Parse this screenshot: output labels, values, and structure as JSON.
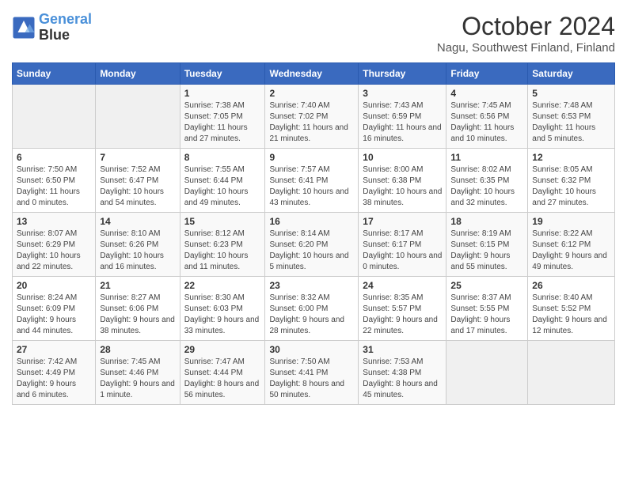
{
  "header": {
    "logo_line1": "General",
    "logo_line2": "Blue",
    "month_title": "October 2024",
    "location": "Nagu, Southwest Finland, Finland"
  },
  "days_of_week": [
    "Sunday",
    "Monday",
    "Tuesday",
    "Wednesday",
    "Thursday",
    "Friday",
    "Saturday"
  ],
  "weeks": [
    [
      {
        "day": "",
        "info": ""
      },
      {
        "day": "",
        "info": ""
      },
      {
        "day": "1",
        "info": "Sunrise: 7:38 AM\nSunset: 7:05 PM\nDaylight: 11 hours and 27 minutes."
      },
      {
        "day": "2",
        "info": "Sunrise: 7:40 AM\nSunset: 7:02 PM\nDaylight: 11 hours and 21 minutes."
      },
      {
        "day": "3",
        "info": "Sunrise: 7:43 AM\nSunset: 6:59 PM\nDaylight: 11 hours and 16 minutes."
      },
      {
        "day": "4",
        "info": "Sunrise: 7:45 AM\nSunset: 6:56 PM\nDaylight: 11 hours and 10 minutes."
      },
      {
        "day": "5",
        "info": "Sunrise: 7:48 AM\nSunset: 6:53 PM\nDaylight: 11 hours and 5 minutes."
      }
    ],
    [
      {
        "day": "6",
        "info": "Sunrise: 7:50 AM\nSunset: 6:50 PM\nDaylight: 11 hours and 0 minutes."
      },
      {
        "day": "7",
        "info": "Sunrise: 7:52 AM\nSunset: 6:47 PM\nDaylight: 10 hours and 54 minutes."
      },
      {
        "day": "8",
        "info": "Sunrise: 7:55 AM\nSunset: 6:44 PM\nDaylight: 10 hours and 49 minutes."
      },
      {
        "day": "9",
        "info": "Sunrise: 7:57 AM\nSunset: 6:41 PM\nDaylight: 10 hours and 43 minutes."
      },
      {
        "day": "10",
        "info": "Sunrise: 8:00 AM\nSunset: 6:38 PM\nDaylight: 10 hours and 38 minutes."
      },
      {
        "day": "11",
        "info": "Sunrise: 8:02 AM\nSunset: 6:35 PM\nDaylight: 10 hours and 32 minutes."
      },
      {
        "day": "12",
        "info": "Sunrise: 8:05 AM\nSunset: 6:32 PM\nDaylight: 10 hours and 27 minutes."
      }
    ],
    [
      {
        "day": "13",
        "info": "Sunrise: 8:07 AM\nSunset: 6:29 PM\nDaylight: 10 hours and 22 minutes."
      },
      {
        "day": "14",
        "info": "Sunrise: 8:10 AM\nSunset: 6:26 PM\nDaylight: 10 hours and 16 minutes."
      },
      {
        "day": "15",
        "info": "Sunrise: 8:12 AM\nSunset: 6:23 PM\nDaylight: 10 hours and 11 minutes."
      },
      {
        "day": "16",
        "info": "Sunrise: 8:14 AM\nSunset: 6:20 PM\nDaylight: 10 hours and 5 minutes."
      },
      {
        "day": "17",
        "info": "Sunrise: 8:17 AM\nSunset: 6:17 PM\nDaylight: 10 hours and 0 minutes."
      },
      {
        "day": "18",
        "info": "Sunrise: 8:19 AM\nSunset: 6:15 PM\nDaylight: 9 hours and 55 minutes."
      },
      {
        "day": "19",
        "info": "Sunrise: 8:22 AM\nSunset: 6:12 PM\nDaylight: 9 hours and 49 minutes."
      }
    ],
    [
      {
        "day": "20",
        "info": "Sunrise: 8:24 AM\nSunset: 6:09 PM\nDaylight: 9 hours and 44 minutes."
      },
      {
        "day": "21",
        "info": "Sunrise: 8:27 AM\nSunset: 6:06 PM\nDaylight: 9 hours and 38 minutes."
      },
      {
        "day": "22",
        "info": "Sunrise: 8:30 AM\nSunset: 6:03 PM\nDaylight: 9 hours and 33 minutes."
      },
      {
        "day": "23",
        "info": "Sunrise: 8:32 AM\nSunset: 6:00 PM\nDaylight: 9 hours and 28 minutes."
      },
      {
        "day": "24",
        "info": "Sunrise: 8:35 AM\nSunset: 5:57 PM\nDaylight: 9 hours and 22 minutes."
      },
      {
        "day": "25",
        "info": "Sunrise: 8:37 AM\nSunset: 5:55 PM\nDaylight: 9 hours and 17 minutes."
      },
      {
        "day": "26",
        "info": "Sunrise: 8:40 AM\nSunset: 5:52 PM\nDaylight: 9 hours and 12 minutes."
      }
    ],
    [
      {
        "day": "27",
        "info": "Sunrise: 7:42 AM\nSunset: 4:49 PM\nDaylight: 9 hours and 6 minutes."
      },
      {
        "day": "28",
        "info": "Sunrise: 7:45 AM\nSunset: 4:46 PM\nDaylight: 9 hours and 1 minute."
      },
      {
        "day": "29",
        "info": "Sunrise: 7:47 AM\nSunset: 4:44 PM\nDaylight: 8 hours and 56 minutes."
      },
      {
        "day": "30",
        "info": "Sunrise: 7:50 AM\nSunset: 4:41 PM\nDaylight: 8 hours and 50 minutes."
      },
      {
        "day": "31",
        "info": "Sunrise: 7:53 AM\nSunset: 4:38 PM\nDaylight: 8 hours and 45 minutes."
      },
      {
        "day": "",
        "info": ""
      },
      {
        "day": "",
        "info": ""
      }
    ]
  ]
}
